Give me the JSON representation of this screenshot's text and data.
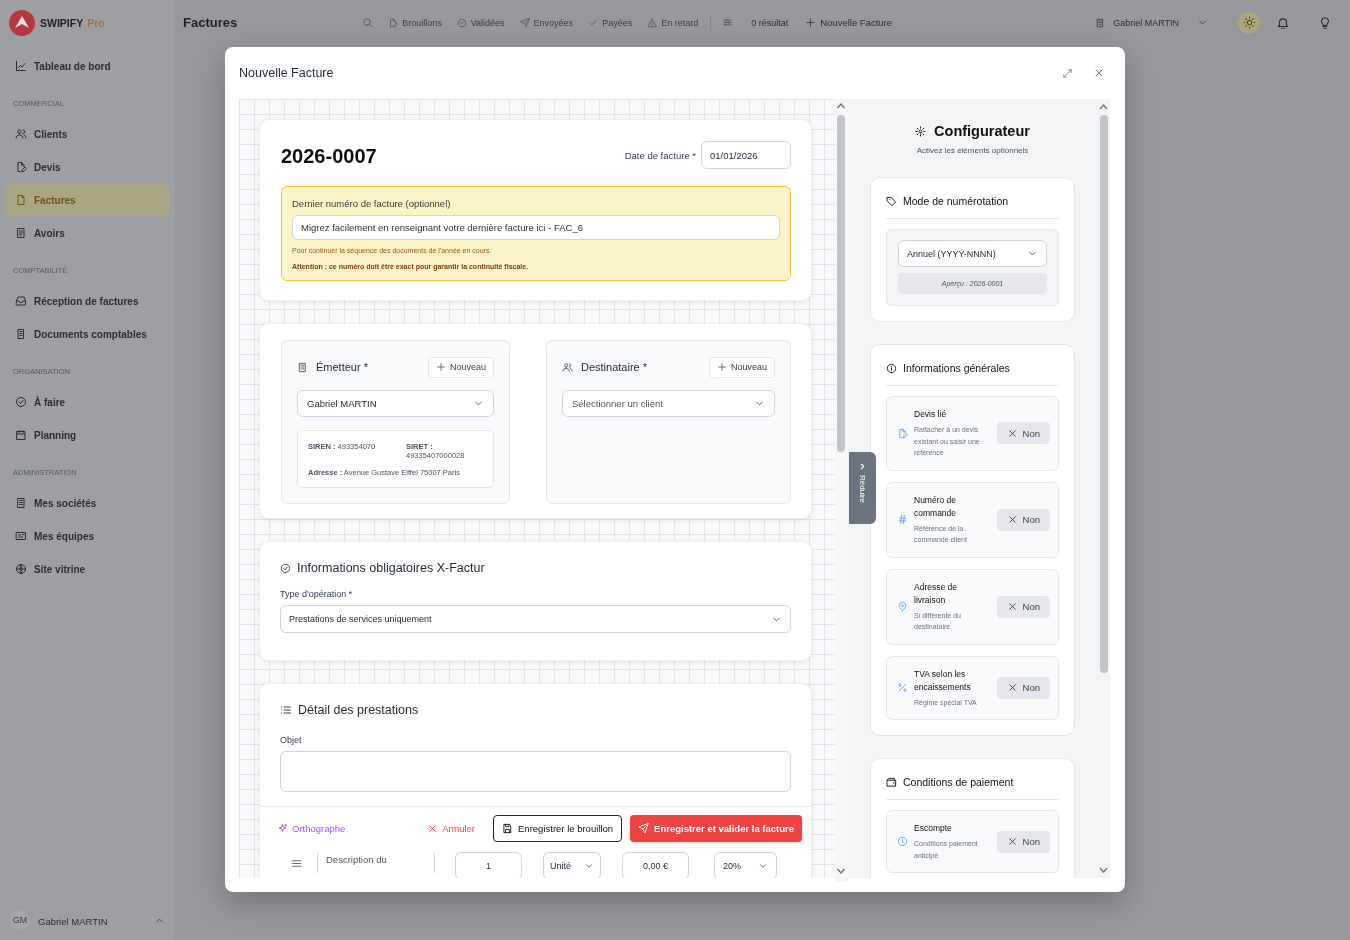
{
  "app": {
    "name": "SWIPIFY",
    "edition": "Pro"
  },
  "sidebar": {
    "sections": [
      {
        "items": [
          {
            "label": "Tableau de bord",
            "selected": false
          }
        ]
      },
      {
        "heading": "COMMERCIAL",
        "items": [
          {
            "label": "Clients",
            "selected": false
          },
          {
            "label": "Devis",
            "selected": false
          },
          {
            "label": "Factures",
            "selected": true
          },
          {
            "label": "Avoirs",
            "selected": false
          }
        ]
      },
      {
        "heading": "COMPTABILITÉ",
        "items": [
          {
            "label": "Réception de factures",
            "selected": false
          },
          {
            "label": "Documents comptables",
            "selected": false
          }
        ]
      },
      {
        "heading": "ORGANISATION",
        "items": [
          {
            "label": "À faire",
            "selected": false
          },
          {
            "label": "Planning",
            "selected": false
          }
        ]
      },
      {
        "heading": "ADMINISTRATION",
        "items": [
          {
            "label": "Mes sociétés",
            "selected": false
          },
          {
            "label": "Mes équipes",
            "selected": false
          },
          {
            "label": "Site vitrine",
            "selected": false
          }
        ]
      }
    ],
    "user": {
      "initials": "GM",
      "name": "Gabriel MARTIN"
    }
  },
  "topbar": {
    "title": "Factures",
    "filters": [
      {
        "label": "Brouillons"
      },
      {
        "label": "Validées"
      },
      {
        "label": "Envoyées"
      },
      {
        "label": "Payées"
      },
      {
        "label": "En retard"
      }
    ],
    "result_count": "0 résultat",
    "new_button": "Nouvelle Facture",
    "user": "Gabriel MARTIN"
  },
  "modal": {
    "title": "Nouvelle Facture",
    "invoice": {
      "number": "2026-0007",
      "date_label": "Date de facture *",
      "date": "01/01/2026",
      "last_number": {
        "label": "Dernier numéro de facture (optionnel)",
        "value": "Migrez facilement en renseignant votre dernière facture ici - FAC_6",
        "hint": "Pour continuer la séquence des documents de l'année en cours.",
        "warning": "Attention : ce numéro doit être exact pour garantir la continuité fiscale."
      }
    },
    "parties": [
      {
        "title": "Émetteur *",
        "new_button": "Nouveau",
        "select": {
          "value": "Gabriel MARTIN"
        },
        "details": [
          "**SIREN :** 493354070",
          "**SIRET :** 49335407000028",
          "**Adresse :** Avenue Gustave Eiffel 75007 Paris"
        ]
      },
      {
        "title": "Destinataire *",
        "new_button": "Nouveau",
        "select": {
          "placeholder": "Sélectionner un client"
        }
      }
    ],
    "xfactur": {
      "title": "Informations obligatoires X-Factur",
      "field_label": "Type d'opération *",
      "value": "Prestations de services uniquement"
    },
    "details": {
      "title": "Détail des prestations",
      "object_label": "Objet",
      "line": {
        "description": "Description du",
        "quantity": "1",
        "unit": "Unité",
        "price": "0,00 €",
        "vat": "20%"
      }
    },
    "actions": {
      "spellcheck": "Orthographe",
      "cancel": "Annuler",
      "save_draft": "Enregistrer le brouillon",
      "validate": "Enregistrer et valider la facture"
    },
    "configurator": {
      "title": "Configurateur",
      "subtitle": "Activez les éléments optionnels",
      "collapse": "Réduire",
      "sections": [
        {
          "kind": "select",
          "title": "Mode de numérotation",
          "value": "Annuel (YYYY-NNNN)",
          "preview": "Aperçu : 2026-0001"
        },
        {
          "kind": "options",
          "title": "Informations générales",
          "options": [
            {
              "title": "Devis lié",
              "description": "Rattacher à un devis existant ou saisir une référence",
              "toggle": "Non",
              "on": false
            },
            {
              "title": "Numéro de commande",
              "description": "Référence de la commande client",
              "toggle": "Non",
              "on": false
            },
            {
              "title": "Adresse de livraison",
              "description": "Si différente du destinataire",
              "toggle": "Non",
              "on": false
            },
            {
              "title": "TVA selon les encaissements",
              "description": "Régime spécial TVA",
              "toggle": "Non",
              "on": false
            }
          ]
        },
        {
          "kind": "options",
          "title": "Conditions de paiement",
          "options": [
            {
              "title": "Escompte",
              "description": "Conditions paiement anticipé",
              "toggle": "Non",
              "on": false
            }
          ]
        }
      ]
    }
  }
}
